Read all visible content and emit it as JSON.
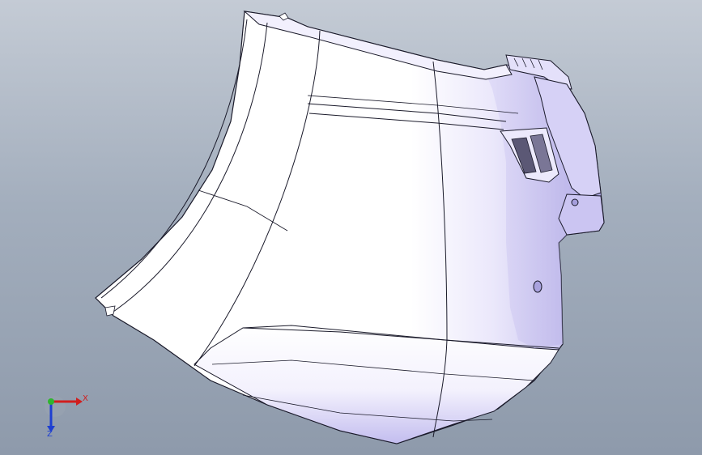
{
  "viewport": {
    "background_top": "#c4cbd5",
    "background_bottom": "#8e9aab"
  },
  "model": {
    "fill": "#ffffff",
    "shade": "#c9c5ee",
    "edge": "#1a1a2a"
  },
  "triad": {
    "x_label": "X",
    "z_label": "Z",
    "x_color": "#d11e1e",
    "y_color": "#2fb52f",
    "z_color": "#1e3fd1"
  }
}
